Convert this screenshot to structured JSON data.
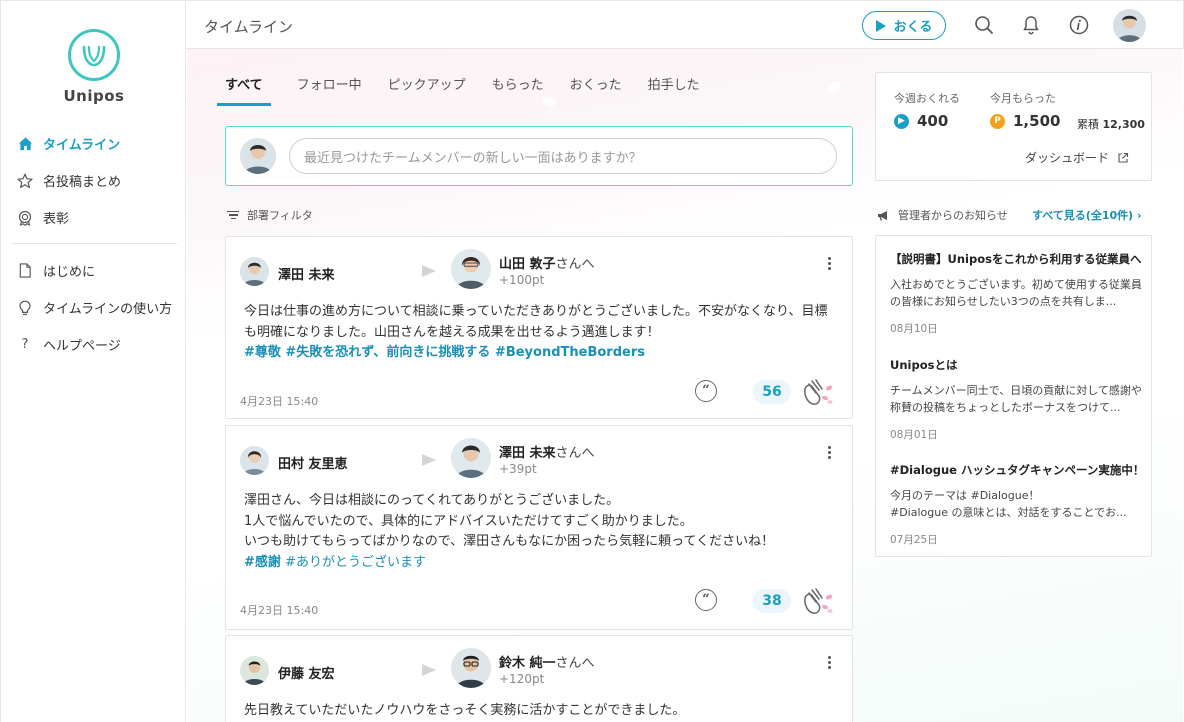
{
  "app": {
    "brand": "Unipos"
  },
  "sidebar": {
    "items": [
      {
        "label": "タイムライン",
        "icon": "home-icon",
        "active": true
      },
      {
        "label": "名投稿まとめ",
        "icon": "star-icon"
      },
      {
        "label": "表彰",
        "icon": "award-icon"
      },
      {
        "label": "はじめに",
        "icon": "document-icon"
      },
      {
        "label": "タイムラインの使い方",
        "icon": "lightbulb-icon"
      },
      {
        "label": "ヘルプページ",
        "icon": "question-icon"
      }
    ]
  },
  "header": {
    "title": "タイムライン",
    "send_label": "おくる",
    "icons": [
      "search-icon",
      "bell-icon",
      "info-icon",
      "user-avatar"
    ]
  },
  "tabs": [
    "すべて",
    "フォロー中",
    "ピックアップ",
    "もらった",
    "おくった",
    "拍手した"
  ],
  "composer": {
    "placeholder": "最近見つけたチームメンバーの新しい一面はありますか？"
  },
  "filter_label": "部署フィルタ",
  "posts": [
    {
      "sender": "澤田 未来",
      "receiver": "山田 敦子",
      "receiver_suffix": "さんへ",
      "points": "+100pt",
      "body": [
        "今日は仕事の進め方について相談に乗っていただきありがとうございました。不安がなくなり、目標",
        "も明確になりました。山田さんを越える成果を出せるよう邁進します！"
      ],
      "tags": "#尊敬 #失敗を恐れず、前向きに挑戦する #BeyondTheBorders",
      "date": "4月23日 15:40",
      "claps": "56"
    },
    {
      "sender": "田村 友里恵",
      "receiver": "澤田 未来",
      "receiver_suffix": "さんへ",
      "points": "+39pt",
      "body": [
        "澤田さん、今日は相談にのってくれてありがとうございました。",
        "1人で悩んでいたので、具体的にアドバイスいただけてすごく助かりました。",
        "いつも助けてもらってばかりなので、澤田さんもなにか困ったら気軽に頼ってくださいね！"
      ],
      "tags_bold": "#感謝",
      "tags_light": "#ありがとうございます",
      "date": "4月23日 15:40",
      "claps": "38"
    },
    {
      "sender": "伊藤 友宏",
      "receiver": "鈴木 純一",
      "receiver_suffix": "さんへ",
      "points": "+120pt",
      "body": [
        "先日教えていただいたノウハウをさっそく実務に活かすことができました。"
      ]
    }
  ],
  "stats": {
    "send_label": "今週おくれる",
    "send_value": "400",
    "recv_label": "今月もらった",
    "recv_value": "1,500",
    "cumulative_label": "累積",
    "cumulative_value": "12,300",
    "dashboard_label": "ダッシュボード",
    "send_coin": "▶",
    "recv_coin": "P"
  },
  "notices": {
    "heading": "管理者からのお知らせ",
    "see_all": "すべて見る(全10件)",
    "items": [
      {
        "title": "【説明書】Uniposをこれから利用する従業員へ",
        "body": "入社おめでとうございます。初めて使用する従業員の皆様にお知らせしたい3つの点を共有しま...",
        "date": "08月10日"
      },
      {
        "title": "Uniposとは",
        "body": "チームメンバー同士で、日頃の貢献に対して感謝や称賛の投稿をちょっとしたボーナスをつけて...",
        "date": "08月01日"
      },
      {
        "title": "#Dialogue ハッシュタグキャンペーン実施中！",
        "body": "今月のテーマは #Dialogue！\n#Dialogue の意味とは、対話をすることでお...",
        "date": "07月25日"
      }
    ]
  },
  "colors": {
    "accent": "#1aa0c5",
    "brand": "#3cc8c1",
    "tag": "#1a8fb8",
    "coin_send": "#1a9fc7",
    "coin_recv": "#f2a21a"
  }
}
